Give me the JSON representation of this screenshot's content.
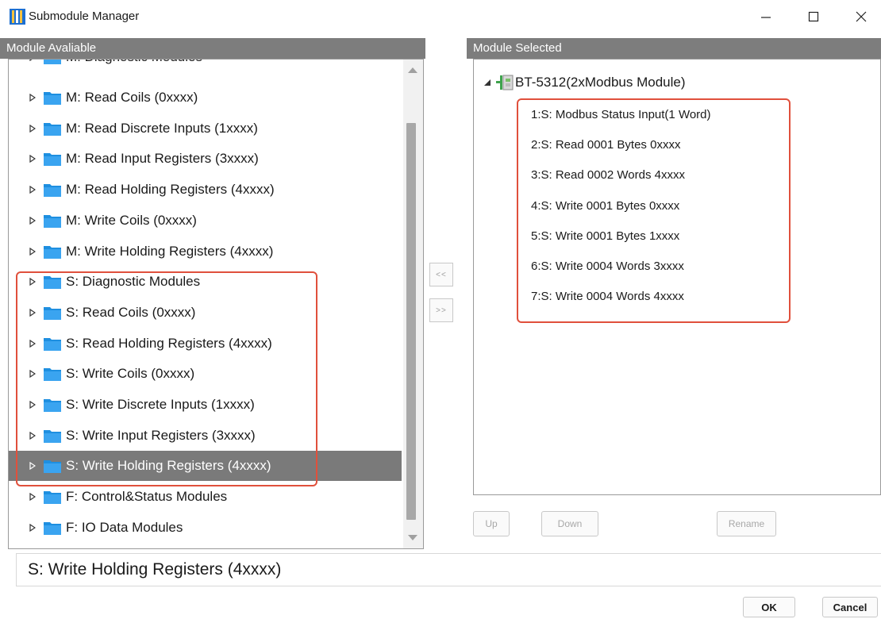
{
  "window": {
    "title": "Submodule Manager"
  },
  "left_panel": {
    "header": "Module Avaliable",
    "cut_item": "M: Diagnostic Modules",
    "items": [
      {
        "label": "M: Read Coils (0xxxx)"
      },
      {
        "label": "M: Read Discrete Inputs (1xxxx)"
      },
      {
        "label": "M: Read Input Registers (3xxxx)"
      },
      {
        "label": "M: Read Holding Registers (4xxxx)"
      },
      {
        "label": "M: Write Coils (0xxxx)"
      },
      {
        "label": "M: Write Holding Registers (4xxxx)"
      },
      {
        "label": "S: Diagnostic Modules"
      },
      {
        "label": "S: Read Coils (0xxxx)"
      },
      {
        "label": "S: Read Holding Registers (4xxxx)"
      },
      {
        "label": "S: Write Coils (0xxxx)"
      },
      {
        "label": "S: Write Discrete Inputs (1xxxx)"
      },
      {
        "label": "S: Write Input Registers (3xxxx)"
      },
      {
        "label": "S: Write Holding Registers (4xxxx)",
        "selected": true
      },
      {
        "label": "F: Control&Status Modules"
      },
      {
        "label": "F: IO Data Modules"
      }
    ]
  },
  "transfer": {
    "remove_label": "<<",
    "add_label": ">>"
  },
  "right_panel": {
    "header": "Module Selected",
    "root_label": "BT-5312(2xModbus Module)",
    "children": [
      "1:S: Modbus Status Input(1 Word)",
      "2:S: Read 0001 Bytes 0xxxx",
      "3:S: Read 0002 Words 4xxxx",
      "4:S: Write 0001 Bytes 0xxxx",
      "5:S: Write 0001 Bytes 1xxxx",
      "6:S: Write 0004 Words 3xxxx",
      "7:S: Write 0004 Words 4xxxx"
    ],
    "buttons": {
      "up": "Up",
      "down": "Down",
      "rename": "Rename"
    }
  },
  "status": {
    "selected_text": "S: Write Holding Registers (4xxxx)"
  },
  "dialog": {
    "ok": "OK",
    "cancel": "Cancel"
  },
  "colors": {
    "highlight_box": "#e0503c",
    "folder": "#1e8fe0",
    "header_bg": "#7d7d7d",
    "selected_bg": "#7a7a7a"
  }
}
